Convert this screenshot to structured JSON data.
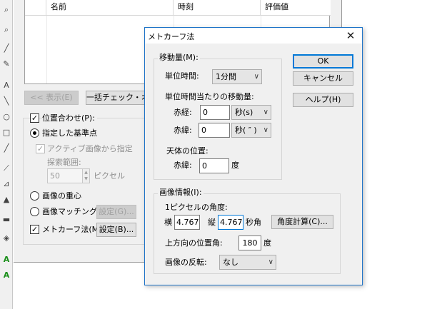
{
  "toolbar": {
    "icons": [
      "zoom-icon",
      "pan-icon",
      "pencil-icon",
      "text-icon",
      "line-icon",
      "circle-icon",
      "rect-icon",
      "brush-icon",
      "eyedropper-icon",
      "measure-icon",
      "stamp-icon",
      "eraser-icon",
      "fill-icon",
      "grid-icon",
      "plot-icon",
      "plot2-icon"
    ]
  },
  "background": {
    "columns": [
      "名前",
      "時刻",
      "評価値"
    ],
    "show_button": "<< 表示(E)",
    "batch_button": "一括チェック・オン",
    "align_check_label": "位置合わせ(P):",
    "radio_ref_star": "指定した基準点",
    "active_image_label": "アクティブ画像から指定",
    "search_range_label": "探索範囲:",
    "search_range_value": "50",
    "pixel_unit": "ピクセル",
    "radio_centroid": "画像の重心",
    "radio_matching": "画像マッチング",
    "settings_g": "設定(G)...",
    "mercator_label": "メトカーフ法(M)",
    "settings_b": "設定(B)..."
  },
  "dialog": {
    "title": "メトカーフ法",
    "close": "✕",
    "movement_group": "移動量(M):",
    "unit_time_label": "単位時間:",
    "unit_time_value": "1分間",
    "per_unit_label": "単位時間当たりの移動量:",
    "ra_label": "赤経:",
    "ra_value": "0",
    "ra_unit": "秒(s)",
    "dec_label": "赤緯:",
    "dec_value": "0",
    "dec_unit": "秒( ″ )",
    "body_pos_label": "天体の位置:",
    "body_dec_label": "赤緯:",
    "body_dec_value": "0",
    "body_dec_unit": "度",
    "ok": "OK",
    "cancel": "キャンセル",
    "help": "ヘルプ(H)",
    "image_info_group": "画像情報(I):",
    "pixel_angle_label": "1ピクセルの角度:",
    "horiz_label": "横",
    "horiz_value": "4.767",
    "vert_label": "縦",
    "vert_value": "4.767",
    "arcsec_label": "秒角",
    "calc_button": "角度計算(C)...",
    "up_angle_label": "上方向の位置角:",
    "up_angle_value": "180",
    "up_angle_unit": "度",
    "flip_label": "画像の反転:",
    "flip_value": "なし"
  },
  "colors": {
    "accent": "#0078d7",
    "dialog_border": "#1e73c8",
    "window_bg": "#f0f0f0"
  }
}
